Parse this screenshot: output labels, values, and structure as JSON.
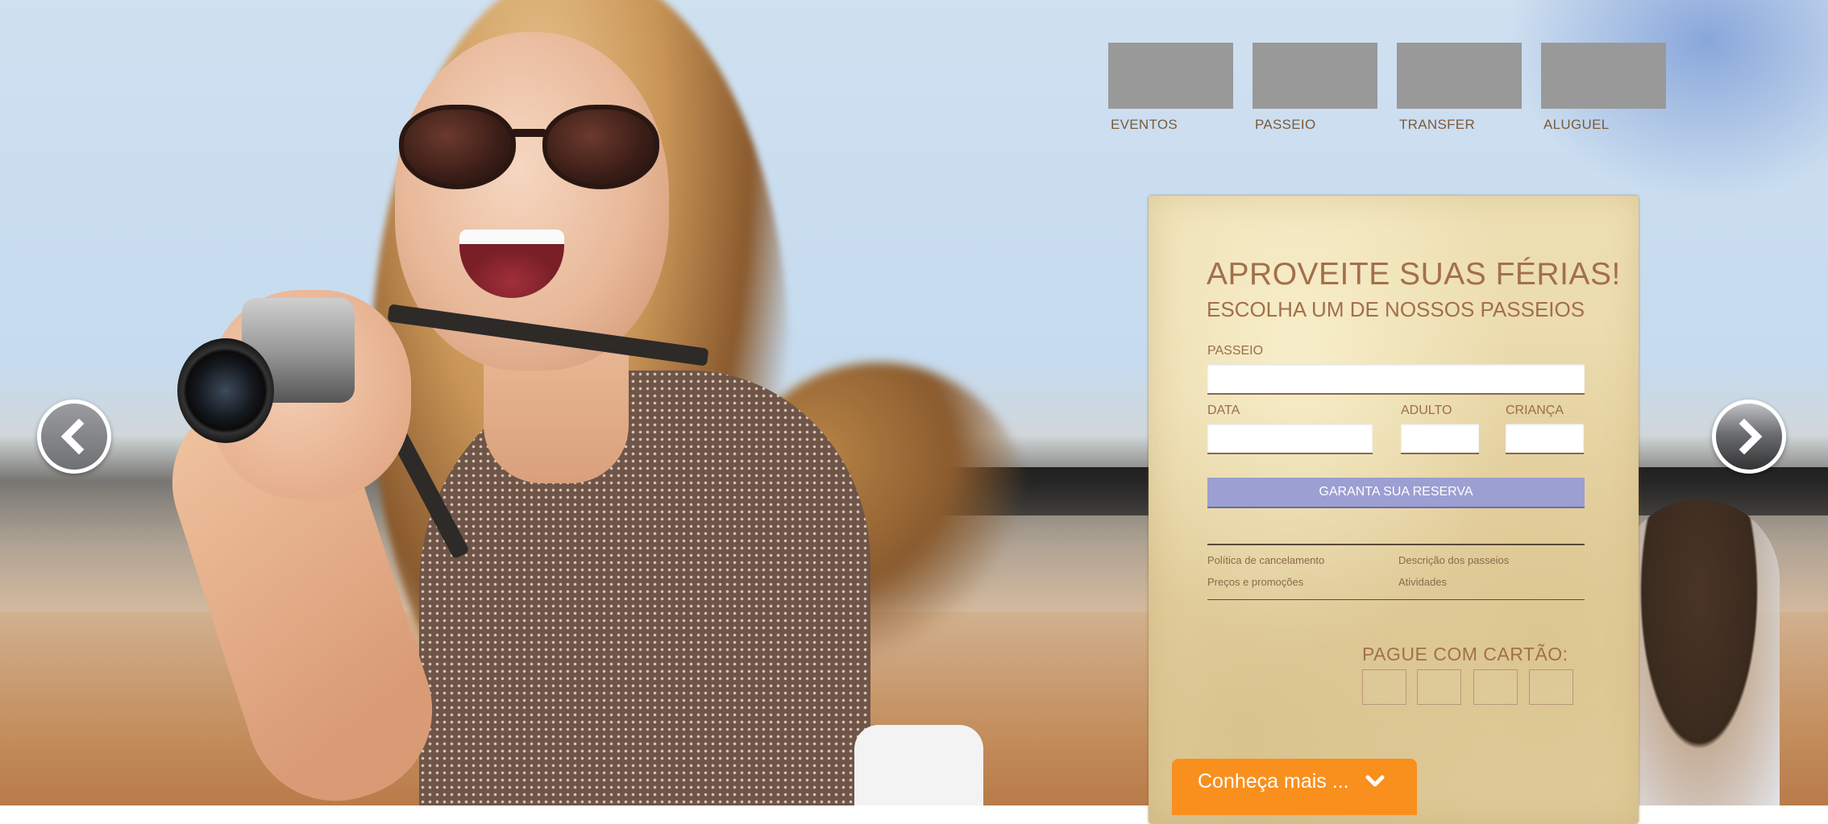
{
  "categories": [
    {
      "label": "EVENTOS"
    },
    {
      "label": "PASSEIO"
    },
    {
      "label": "TRANSFER"
    },
    {
      "label": "ALUGUEL"
    }
  ],
  "carousel": {
    "prev_icon": "chevron-left-icon",
    "next_icon": "chevron-right-icon"
  },
  "booking": {
    "title": "APROVEITE SUAS FÉRIAS!",
    "subtitle": "ESCOLHA UM DE NOSSOS PASSEIOS",
    "passeio_label": "PASSEIO",
    "passeio_value": "",
    "data_label": "DATA",
    "data_value": "",
    "adulto_label": "ADULTO",
    "adulto_value": "",
    "crianca_label": "CRIANÇA",
    "crianca_value": "",
    "reserve_label": "GARANTA SUA RESERVA",
    "links": {
      "cancel_policy": "Política de cancelamento",
      "descriptions": "Descrição dos passeios",
      "prices": "Preços e promoções",
      "activities": "Atividades"
    },
    "pay_title": "PAGUE COM CARTÃO:"
  },
  "more_button": {
    "label": "Conheça mais ...",
    "icon": "chevron-down-icon"
  },
  "colors": {
    "accent_orange": "#f98f1d",
    "reserve_button": "#9b9fd2",
    "panel_text": "#a2704a",
    "category_thumb": "#999999"
  }
}
